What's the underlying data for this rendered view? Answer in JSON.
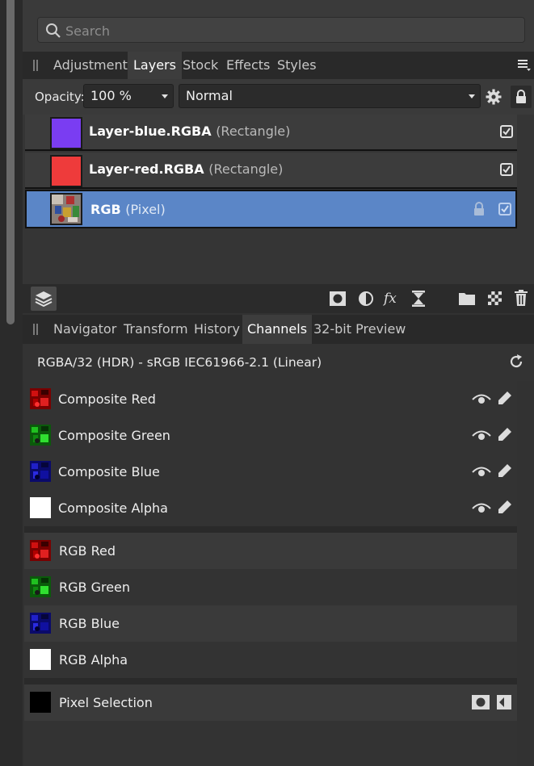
{
  "search": {
    "placeholder": "Search"
  },
  "studio_tabs": [
    "Adjustment",
    "Layers",
    "Stock",
    "Effects",
    "Styles"
  ],
  "layers": {
    "opacity_label": "Opacity:",
    "opacity_value": "100 %",
    "blend_mode": "Normal",
    "items": [
      {
        "name": "Layer-blue.RGBA",
        "kind": "(Rectangle)",
        "color": "#7a3df2",
        "visible": true,
        "selected": false
      },
      {
        "name": "Layer-red.RGBA",
        "kind": "(Rectangle)",
        "color": "#ee3b3b",
        "visible": true,
        "selected": false
      },
      {
        "name": "RGB",
        "kind": "(Pixel)",
        "color": "image",
        "visible": true,
        "selected": true,
        "locked": true
      }
    ]
  },
  "lower_tabs": [
    "Navigator",
    "Transform",
    "History",
    "Channels",
    "32-bit Preview"
  ],
  "channels": {
    "profile": "RGBA/32 (HDR) - sRGB IEC61966-2.1 (Linear)",
    "composite": [
      {
        "name": "Composite Red",
        "swatch": "red"
      },
      {
        "name": "Composite Green",
        "swatch": "green"
      },
      {
        "name": "Composite Blue",
        "swatch": "blue"
      },
      {
        "name": "Composite Alpha",
        "swatch": "white"
      }
    ],
    "layer": [
      {
        "name": "RGB Red",
        "swatch": "red"
      },
      {
        "name": "RGB Green",
        "swatch": "green"
      },
      {
        "name": "RGB Blue",
        "swatch": "blue"
      },
      {
        "name": "RGB Alpha",
        "swatch": "white"
      }
    ],
    "selection": {
      "name": "Pixel Selection",
      "swatch": "black"
    }
  },
  "colors": {
    "selected_row": "#5b86c7",
    "panel": "#333333"
  }
}
